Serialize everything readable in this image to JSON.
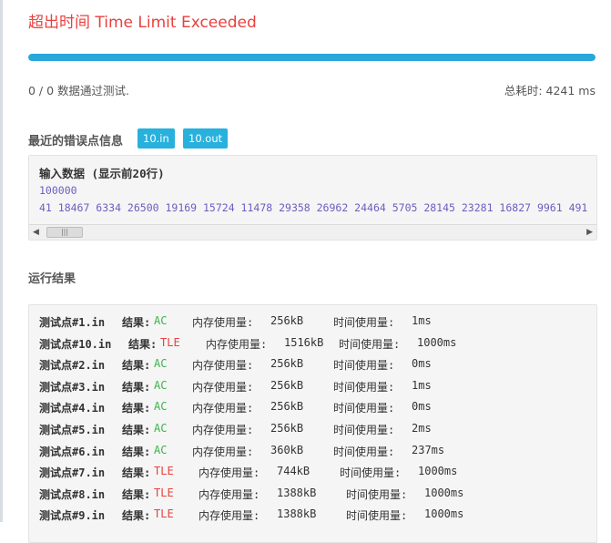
{
  "header": {
    "title": "超出时间 Time Limit Exceeded"
  },
  "progress": {
    "percent": 100,
    "color": "#28a7db"
  },
  "summary": {
    "passed_text": "0 / 0 数据通过测试.",
    "total_time_text": "总耗时: 4241 ms"
  },
  "error_section": {
    "title": "最近的错误点信息",
    "in_file": "10.in",
    "out_file": "10.out"
  },
  "input_box": {
    "heading": "输入数据 (显示前20行)",
    "line1": "100000",
    "line2": "41 18467 6334 26500 19169 15724 11478 29358 26962 24464 5705 28145 23281 16827 9961 491"
  },
  "scrollbar": {
    "left_arrow": "◀",
    "right_arrow": "▶",
    "thumb_grip": "|||"
  },
  "results_section": {
    "title": "运行结果",
    "result_label": "结果:",
    "memory_label": "内存使用量:",
    "time_label": "时间使用量:",
    "rows": [
      {
        "name": "测试点#1.in",
        "status": "AC",
        "memory": "256kB",
        "time": "1ms"
      },
      {
        "name": "测试点#10.in",
        "status": "TLE",
        "memory": "1516kB",
        "time": "1000ms"
      },
      {
        "name": "测试点#2.in",
        "status": "AC",
        "memory": "256kB",
        "time": "0ms"
      },
      {
        "name": "测试点#3.in",
        "status": "AC",
        "memory": "256kB",
        "time": "1ms"
      },
      {
        "name": "测试点#4.in",
        "status": "AC",
        "memory": "256kB",
        "time": "0ms"
      },
      {
        "name": "测试点#5.in",
        "status": "AC",
        "memory": "256kB",
        "time": "2ms"
      },
      {
        "name": "测试点#6.in",
        "status": "AC",
        "memory": "360kB",
        "time": "237ms"
      },
      {
        "name": "测试点#7.in",
        "status": "TLE",
        "memory": "744kB",
        "time": "1000ms"
      },
      {
        "name": "测试点#8.in",
        "status": "TLE",
        "memory": "1388kB",
        "time": "1000ms"
      },
      {
        "name": "测试点#9.in",
        "status": "TLE",
        "memory": "1388kB",
        "time": "1000ms"
      }
    ]
  },
  "colors": {
    "ac": "#3cb44b",
    "tle": "#e8413e",
    "title": "#e8413e",
    "button": "#28b1dd"
  }
}
